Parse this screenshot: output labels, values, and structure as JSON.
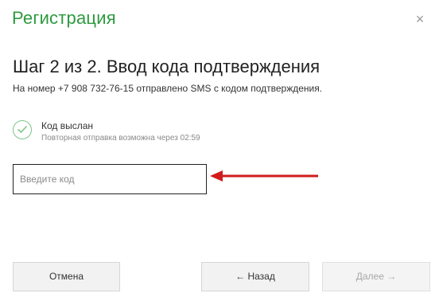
{
  "dialog": {
    "title": "Регистрация",
    "close_glyph": "×",
    "close_icon": "close-icon"
  },
  "step": {
    "heading": "Шаг 2 из 2. Ввод кода подтверждения",
    "sms_note": "На номер +7 908 732-76-15 отправлено SMS с кодом подтверждения."
  },
  "status": {
    "icon": "check-circle-icon",
    "title": "Код выслан",
    "resend_note": "Повторная отправка возможна через 02:59"
  },
  "code_input": {
    "value": "",
    "placeholder": "Введите код"
  },
  "annotation": {
    "icon": "red-arrow-icon",
    "color": "#d01c1c"
  },
  "buttons": {
    "cancel": "Отмена",
    "back": "← Назад",
    "next": "Далее →"
  },
  "colors": {
    "brand_green": "#2d9a3f",
    "check_green": "#7cc489"
  }
}
